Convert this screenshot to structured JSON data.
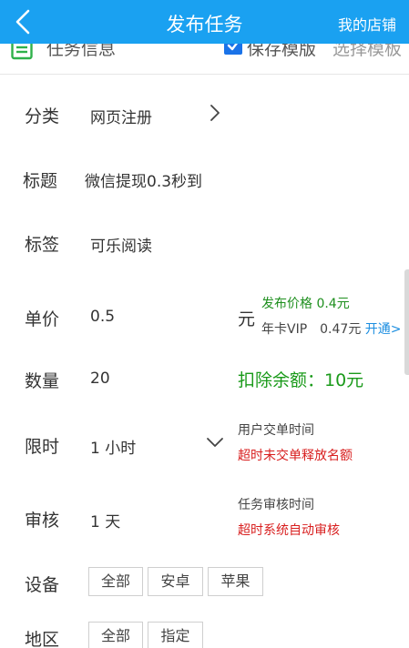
{
  "header": {
    "title": "发布任务",
    "right_link": "我的店铺"
  },
  "subbar": {
    "title": "任务信息",
    "save_template": "保存模版",
    "choose_template": "选择模板"
  },
  "form": {
    "category": {
      "label": "分类",
      "value": "网页注册"
    },
    "title": {
      "label": "标题",
      "value": "微信提现0.3秒到"
    },
    "tag": {
      "label": "标签",
      "value": "可乐阅读"
    },
    "price": {
      "label": "单价",
      "value": "0.5",
      "unit": "元",
      "publish_price": "发布价格 0.4元",
      "vip_price": "年卡VIP　0.47元",
      "vip_open": "开通>"
    },
    "quantity": {
      "label": "数量",
      "value": "20",
      "deduct": "扣除余额：10元"
    },
    "time_limit": {
      "label": "限时",
      "value": "1 小时",
      "note_title": "用户交单时间",
      "note_red": "超时未交单释放名额"
    },
    "review": {
      "label": "审核",
      "value": "1 天",
      "note_title": "任务审核时间",
      "note_red": "超时系统自动审核"
    },
    "device": {
      "label": "设备",
      "options": [
        "全部",
        "安卓",
        "苹果"
      ]
    },
    "region": {
      "label": "地区",
      "options": [
        "全部",
        "指定"
      ]
    }
  },
  "colors": {
    "header_bg": "#1aa1f1",
    "green": "#1a9a1a",
    "red": "#d81e1e",
    "link_blue": "#1a8de0"
  }
}
